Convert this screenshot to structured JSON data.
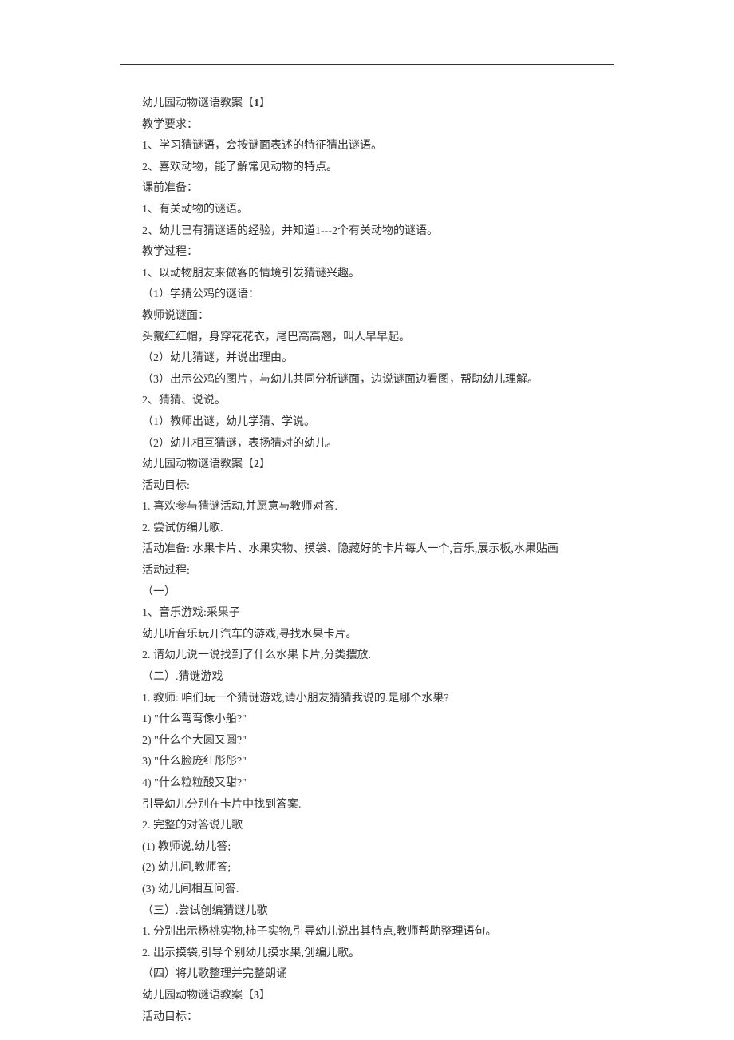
{
  "lines": [
    {
      "text": "幼儿园动物谜语教案【",
      "bold": "1",
      "tail": "】"
    },
    {
      "text": "教学要求："
    },
    {
      "text": "1、学习猜谜语，会按谜面表述的特征猜出谜语。"
    },
    {
      "text": "2、喜欢动物，能了解常见动物的特点。"
    },
    {
      "text": "课前准备："
    },
    {
      "text": "1、有关动物的谜语。"
    },
    {
      "text": "2、幼儿已有猜谜语的经验，并知道1---2个有关动物的谜语。"
    },
    {
      "text": "教学过程："
    },
    {
      "text": "1、以动物朋友来做客的情境引发猜谜兴趣。"
    },
    {
      "text": "（1）学猜公鸡的谜语："
    },
    {
      "text": "教师说谜面："
    },
    {
      "text": "头戴红红帽，身穿花花衣，尾巴高高翘，叫人早早起。"
    },
    {
      "text": "（2）幼儿猜谜，并说出理由。"
    },
    {
      "text": "（3）出示公鸡的图片，与幼儿共同分析谜面，边说谜面边看图，帮助幼儿理解。"
    },
    {
      "text": "2、猜猜、说说。"
    },
    {
      "text": "（1）教师出谜，幼儿学猜、学说。"
    },
    {
      "text": "（2）幼儿相互猜谜，表扬猜对的幼儿。"
    },
    {
      "text": "幼儿园动物谜语教案【",
      "bold": "2",
      "tail": "】"
    },
    {
      "text": "活动目标:"
    },
    {
      "text": "1. 喜欢参与猜谜活动,并愿意与教师对答."
    },
    {
      "text": "2. 尝试仿编儿歌."
    },
    {
      "text": "活动准备: 水果卡片、水果实物、摸袋、隐藏好的卡片每人一个,音乐,展示板,水果贴画"
    },
    {
      "text": "活动过程:"
    },
    {
      "text": "（一）"
    },
    {
      "text": "1、音乐游戏:采果子"
    },
    {
      "text": "幼儿听音乐玩开汽车的游戏,寻找水果卡片。"
    },
    {
      "text": "2. 请幼儿说一说找到了什么水果卡片,分类摆放."
    },
    {
      "text": "（二）.猜谜游戏"
    },
    {
      "text": "1. 教师: 咱们玩一个猜谜游戏,请小朋友猜猜我说的.是哪个水果?"
    },
    {
      "text": "1) \"什么弯弯像小船?\""
    },
    {
      "text": "2) \"什么个大圆又圆?\""
    },
    {
      "text": "3) \"什么脸庞红彤彤?\""
    },
    {
      "text": "4) \"什么粒粒酸又甜?\""
    },
    {
      "text": "引导幼儿分别在卡片中找到答案."
    },
    {
      "text": "2. 完整的对答说儿歌"
    },
    {
      "text": "(1) 教师说,幼儿答;"
    },
    {
      "text": "(2) 幼儿问,教师答;"
    },
    {
      "text": "(3) 幼儿间相互问答."
    },
    {
      "text": "（三）.尝试创编猜谜儿歌"
    },
    {
      "text": "1. 分别出示杨桃实物,柿子实物,引导幼儿说出其特点,教师帮助整理语句。"
    },
    {
      "text": "2. 出示摸袋,引导个别幼儿摸水果,创编儿歌。"
    },
    {
      "text": "（四）将儿歌整理并完整朗诵"
    },
    {
      "text": "幼儿园动物谜语教案【",
      "bold": "3",
      "tail": "】"
    },
    {
      "text": "活动目标："
    }
  ]
}
